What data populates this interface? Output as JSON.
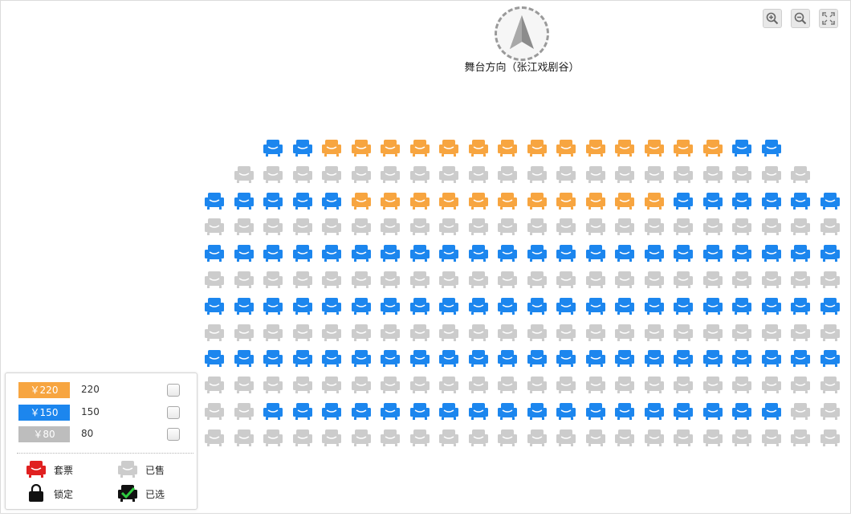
{
  "stage": {
    "label": "舞台方向（张江戏剧谷）"
  },
  "zoom": {
    "zoom_in": "zoom-in",
    "zoom_out": "zoom-out",
    "fullscreen": "fullscreen"
  },
  "colors": {
    "orange": "#f7a540",
    "blue": "#1c86ee",
    "gray": "#cccccc"
  },
  "seat_rows": [
    "..BBOOOOOOOOOOOOOOBB..",
    ".GGGGGGGGGGGGGGGGGGGG.",
    "BBBBBOOOOOOOOOOOBBBBBB",
    "GGGGGGGGGGGGGGGGGGGGGG",
    "BBBBBBBBBBBBBBBBBBBBBB",
    "GGGGGGGGGGGGGGGGGGGGGG",
    "BBBBBBBBBBBBBBBBBBBBBB",
    "GGGGGGGGGGGGGGGGGGGGGG",
    "BBBBBBBBBBBBBBBBBBBBBB",
    "GGGGGGGGGGGGGGGGGGGGGG",
    "GGBBBBBBBBBBBBBBBBBBGG",
    "GGGGGGGGGGGGGGGGGGGGGG"
  ],
  "legend": {
    "prices": [
      {
        "tag": "￥220",
        "value": "220",
        "color": "#f7a540"
      },
      {
        "tag": "￥150",
        "value": "150",
        "color": "#1c86ee"
      },
      {
        "tag": "￥80",
        "value": "80",
        "color": "#bdbdbd"
      }
    ],
    "status": {
      "package_label": "套票",
      "sold_label": "已售",
      "locked_label": "锁定",
      "selected_label": "已选"
    }
  }
}
